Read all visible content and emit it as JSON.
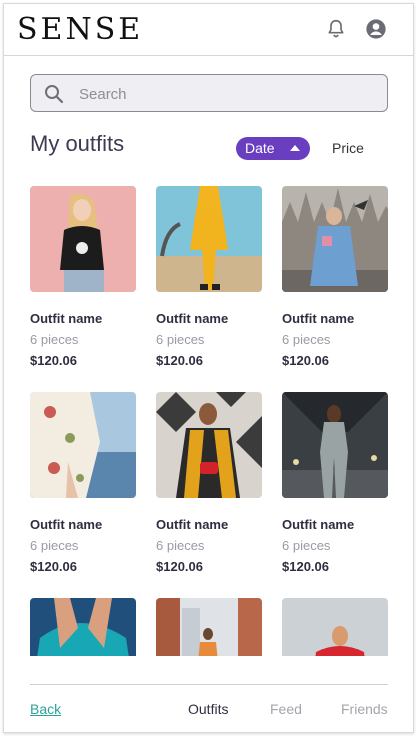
{
  "header": {
    "logo": "SENSE",
    "icons": [
      "bell-icon",
      "user-icon"
    ]
  },
  "search": {
    "placeholder": "Search",
    "value": ""
  },
  "main": {
    "title": "My outfits",
    "sort": {
      "active": "Date",
      "inactive": "Price",
      "accent": "#6a3fbf"
    }
  },
  "outfits": [
    {
      "name": "Outfit name",
      "pieces": "6 pieces",
      "price": "$120.06"
    },
    {
      "name": "Outfit name",
      "pieces": "6 pieces",
      "price": "$120.06"
    },
    {
      "name": "Outfit name",
      "pieces": "6 pieces",
      "price": "$120.06"
    },
    {
      "name": "Outfit name",
      "pieces": "6 pieces",
      "price": "$120.06"
    },
    {
      "name": "Outfit name",
      "pieces": "6 pieces",
      "price": "$120.06"
    },
    {
      "name": "Outfit name",
      "pieces": "6 pieces",
      "price": "$120.06"
    }
  ],
  "bottom_nav": {
    "back": "Back",
    "items": [
      "Outfits",
      "Feed",
      "Friends"
    ],
    "active": "Outfits",
    "link_color": "#2aa39a"
  }
}
